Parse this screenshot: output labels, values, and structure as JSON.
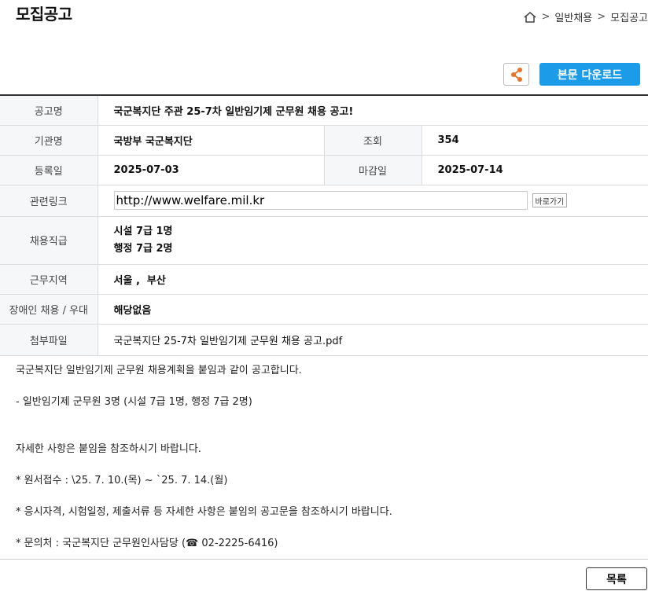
{
  "page": {
    "title": "모집공고",
    "breadcrumb": {
      "sep": ">",
      "items": [
        "일반채용",
        "모집공고"
      ]
    }
  },
  "actions": {
    "download_label": "본문 다운로드"
  },
  "info": {
    "title_label": "공고명",
    "title_value": "국군복지단 주관 25-7차 일반임기제 군무원 채용 공고!",
    "org_label": "기관명",
    "org_value": "국방부 국군복지단",
    "views_label": "조회",
    "views_value": "354",
    "reg_label": "등록일",
    "reg_value": "2025-07-03",
    "deadline_label": "마감일",
    "deadline_value": "2025-07-14",
    "link_label": "관련링크",
    "link_value": "http://www.welfare.mil.kr",
    "link_go": "바로가기",
    "job_label": "채용직급",
    "job_values": [
      "시설 7급 1명",
      "행정 7급 2명"
    ],
    "region_label": "근무지역",
    "region_value": "서울 ,  부산",
    "disability_label": "장애인 채용 / 우대",
    "disability_value": "해당없음",
    "attach_label": "첨부파일",
    "attach_value": "국군복지단 25-7차 일반임기제 군무원 채용 공고.pdf"
  },
  "content": {
    "lines": [
      "국군복지단 일반임기제 군무원 채용계획을 붙임과 같이 공고합니다.",
      "",
      "- 일반임기제 군무원 3명 (시설 7급 1명, 행정 7급 2명)",
      "",
      "",
      "자세한 사항은 붙임을 참조하시기 바랍니다.",
      "",
      "* 원서접수 : \\25. 7. 10.(목) ~ `25. 7. 14.(월)",
      "",
      "* 응시자격, 시험일정, 제출서류 등 자세한 사항은 붙임의 공고문을 참조하시기 바랍니다.",
      "",
      "* 문의처 : 국군복지단 군무원인사담당 (☎ 02-2225-6416)"
    ]
  },
  "footer": {
    "list_label": "목록"
  },
  "colors": {
    "accent": "#1c9be8",
    "share_icon": "#e8742a",
    "label_bg": "#f6f7f9"
  },
  "icons": [
    "home-icon",
    "share-icon"
  ]
}
